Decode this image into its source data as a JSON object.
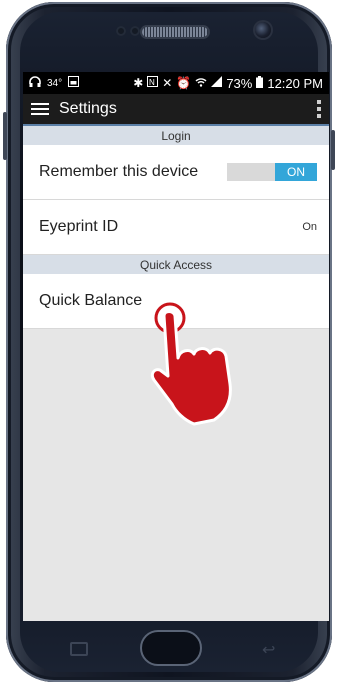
{
  "status_bar": {
    "temperature": "34°",
    "battery": "73%",
    "time": "12:20 PM"
  },
  "app_bar": {
    "title": "Settings"
  },
  "sections": [
    {
      "header": "Login",
      "rows": [
        {
          "label": "Remember this device",
          "toggle": "ON"
        },
        {
          "label": "Eyeprint ID",
          "value": "On"
        }
      ]
    },
    {
      "header": "Quick Access",
      "rows": [
        {
          "label": "Quick Balance"
        }
      ]
    }
  ],
  "colors": {
    "toggle_on": "#33a6d9",
    "section_border": "#5b7fa6",
    "hand": "#c8141b"
  }
}
